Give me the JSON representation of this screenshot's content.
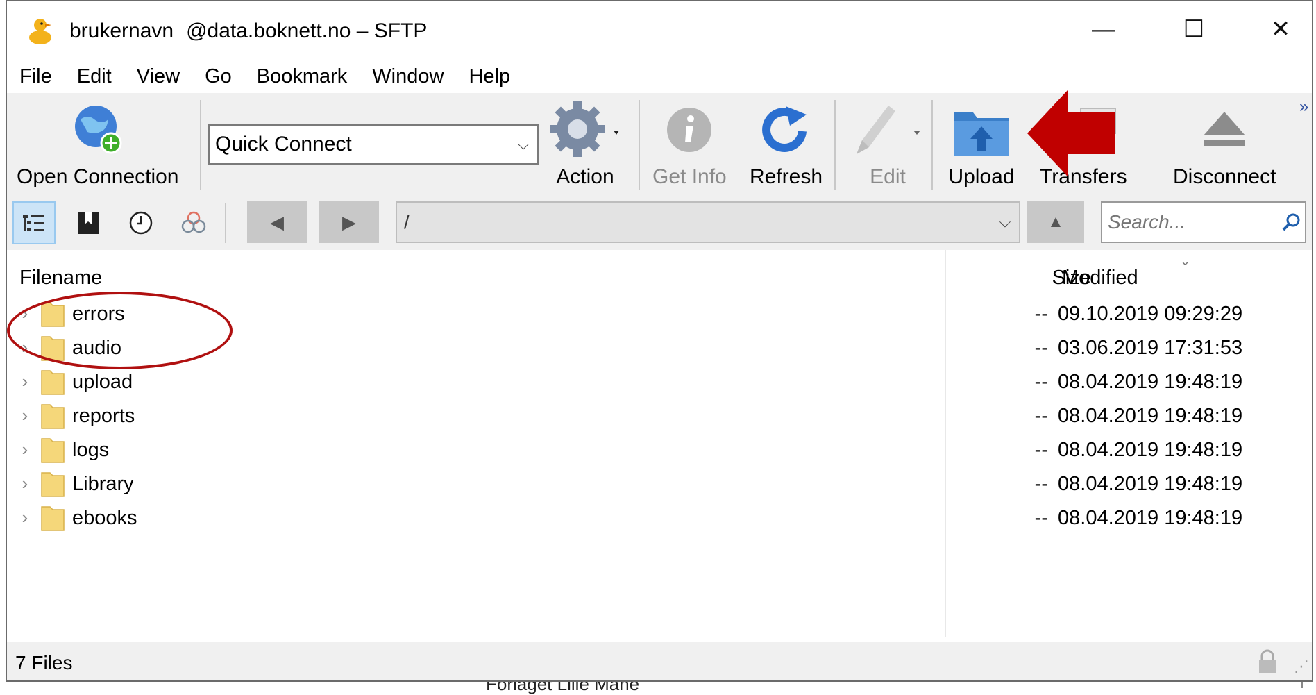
{
  "window": {
    "title_user": "brukernavn",
    "title_host": "@data.boknett.no – SFTP",
    "minimize_glyph": "—",
    "maximize_glyph": "☐",
    "close_glyph": "✕"
  },
  "menu": [
    "File",
    "Edit",
    "View",
    "Go",
    "Bookmark",
    "Window",
    "Help"
  ],
  "toolbar": {
    "open_connection": "Open Connection",
    "quick_connect_value": "Quick Connect",
    "action": "Action",
    "get_info": "Get Info",
    "refresh": "Refresh",
    "edit": "Edit",
    "upload": "Upload",
    "transfers": "Transfers",
    "disconnect": "Disconnect",
    "overflow": "»"
  },
  "nav": {
    "path_value": "/",
    "search_placeholder": "Search...",
    "back_glyph": "◀",
    "forward_glyph": "▶",
    "up_glyph": "▲"
  },
  "list": {
    "columns": {
      "filename": "Filename",
      "size": "Size",
      "modified": "Modified"
    },
    "sort_indicator": "⌄",
    "rows": [
      {
        "name": "errors",
        "size": "--",
        "modified": "09.10.2019 09:29:29"
      },
      {
        "name": "audio",
        "size": "--",
        "modified": "03.06.2019 17:31:53"
      },
      {
        "name": "upload",
        "size": "--",
        "modified": "08.04.2019 19:48:19"
      },
      {
        "name": "reports",
        "size": "--",
        "modified": "08.04.2019 19:48:19"
      },
      {
        "name": "logs",
        "size": "--",
        "modified": "08.04.2019 19:48:19"
      },
      {
        "name": "Library",
        "size": "--",
        "modified": "08.04.2019 19:48:19"
      },
      {
        "name": "ebooks",
        "size": "--",
        "modified": "08.04.2019 19:48:19"
      }
    ]
  },
  "status": {
    "text": "7 Files"
  },
  "background": {
    "bottom_text": "Forlaget Lille Måne"
  },
  "colors": {
    "annotation": "#b01010",
    "folder": "#f5d77a",
    "toolbar_bg": "#f0f0f0"
  }
}
